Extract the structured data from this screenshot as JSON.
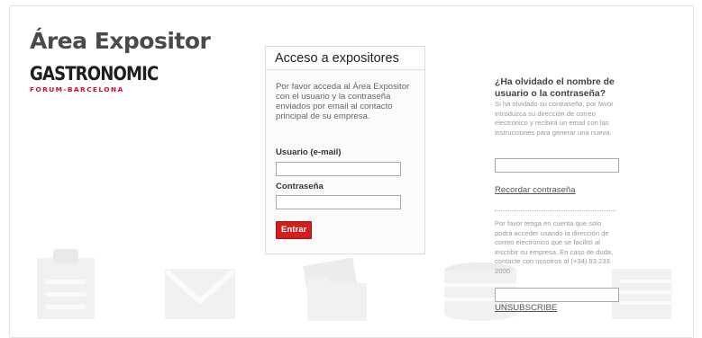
{
  "header": {
    "title": "Área Expositor",
    "logo_main": "GASTRONOMIC",
    "logo_sub": "FORUM-BARCELONA"
  },
  "login_panel": {
    "title": "Acceso a expositores",
    "intro": "Por favor acceda al Área Expositor con el usuario y la contraseña enviados por email al contacto principal de su empresa.",
    "username_label": "Usuario (e-mail)",
    "username_value": "",
    "password_label": "Contraseña",
    "password_value": "",
    "submit_label": "Entrar"
  },
  "forgot": {
    "title": "¿Ha olvidado el nombre de usuario o la contraseña?",
    "text": "Si ha olvidado su contraseña, por favor introduzca su dirección de correo electrónico y recibirá un email con las instrucciones para generar una nueva.",
    "email_value": "",
    "link_label": "Recordar contraseña"
  },
  "unsubscribe": {
    "note": "Por favor tenga en cuenta que solo podrá acceder usando la dirección de correo electrónico que se facilitó al inscribir su empresa. En caso de duda, contacte con nosotros al (+34) 93 233 2000",
    "email_value": "",
    "link_label": "UNSUBSCRIBE"
  },
  "background_icons": [
    "clipboard-icon",
    "envelope-icon",
    "folders-icon",
    "coin-stack-icon",
    "document-lines-icon"
  ],
  "colors": {
    "accent_red": "#d01f1f",
    "logo_red": "#c8102e",
    "title_gray": "#4a4a4a"
  }
}
